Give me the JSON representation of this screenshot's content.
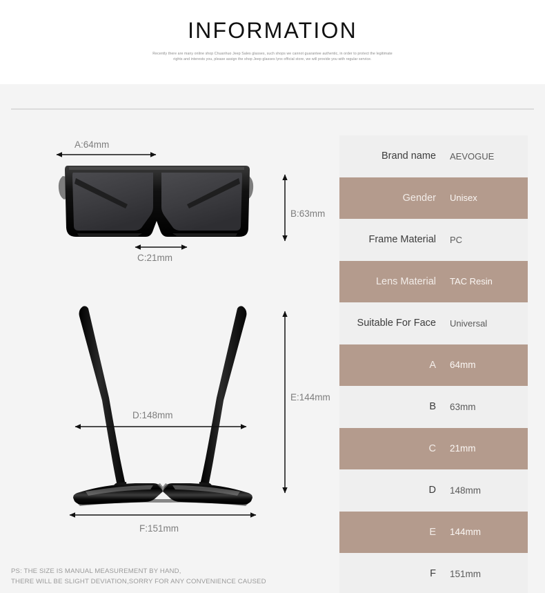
{
  "header": {
    "title": "INFORMATION",
    "subtitle": "Recently there are many online shop Chuanhuo Jeep Sales glasses, such shops we cannot guarantee authentic, in order to protect the legitimate rights and interests you, please assign the shop Jeep glasses lynx official store, we will provide you with regular service."
  },
  "spec_table": {
    "rows": [
      {
        "label": "Brand name",
        "value": "AEVOGUE",
        "style": "light"
      },
      {
        "label": "Gender",
        "value": "Unisex",
        "style": "tan"
      },
      {
        "label": "Frame Material",
        "value": "PC",
        "style": "light"
      },
      {
        "label": "Lens Material",
        "value": "TAC Resin",
        "style": "tan"
      },
      {
        "label": "Suitable For Face",
        "value": "Universal",
        "style": "light"
      },
      {
        "label": "A",
        "value": "64mm",
        "style": "tan"
      },
      {
        "label": "B",
        "value": "63mm",
        "style": "light"
      },
      {
        "label": "C",
        "value": "21mm",
        "style": "tan"
      },
      {
        "label": "D",
        "value": "148mm",
        "style": "light"
      },
      {
        "label": "E",
        "value": "144mm",
        "style": "tan"
      },
      {
        "label": "F",
        "value": "151mm",
        "style": "light"
      }
    ]
  },
  "diagram": {
    "front_view": {
      "measurements": {
        "a": "A:64mm",
        "b": "B:63mm",
        "c": "C:21mm"
      }
    },
    "top_view": {
      "measurements": {
        "d": "D:148mm",
        "e": "E:144mm",
        "f": "F:151mm"
      }
    }
  },
  "footer": {
    "line1": "PS: THE SIZE IS MANUAL MEASUREMENT BY HAND,",
    "line2": "THERE WILL BE SLIGHT DEVIATION,SORRY FOR ANY CONVENIENCE CAUSED"
  },
  "colors": {
    "accent_tan": "#b49b8d",
    "row_light": "#efefef",
    "page_bg": "#f4f4f4",
    "header_bg": "#ffffff"
  }
}
